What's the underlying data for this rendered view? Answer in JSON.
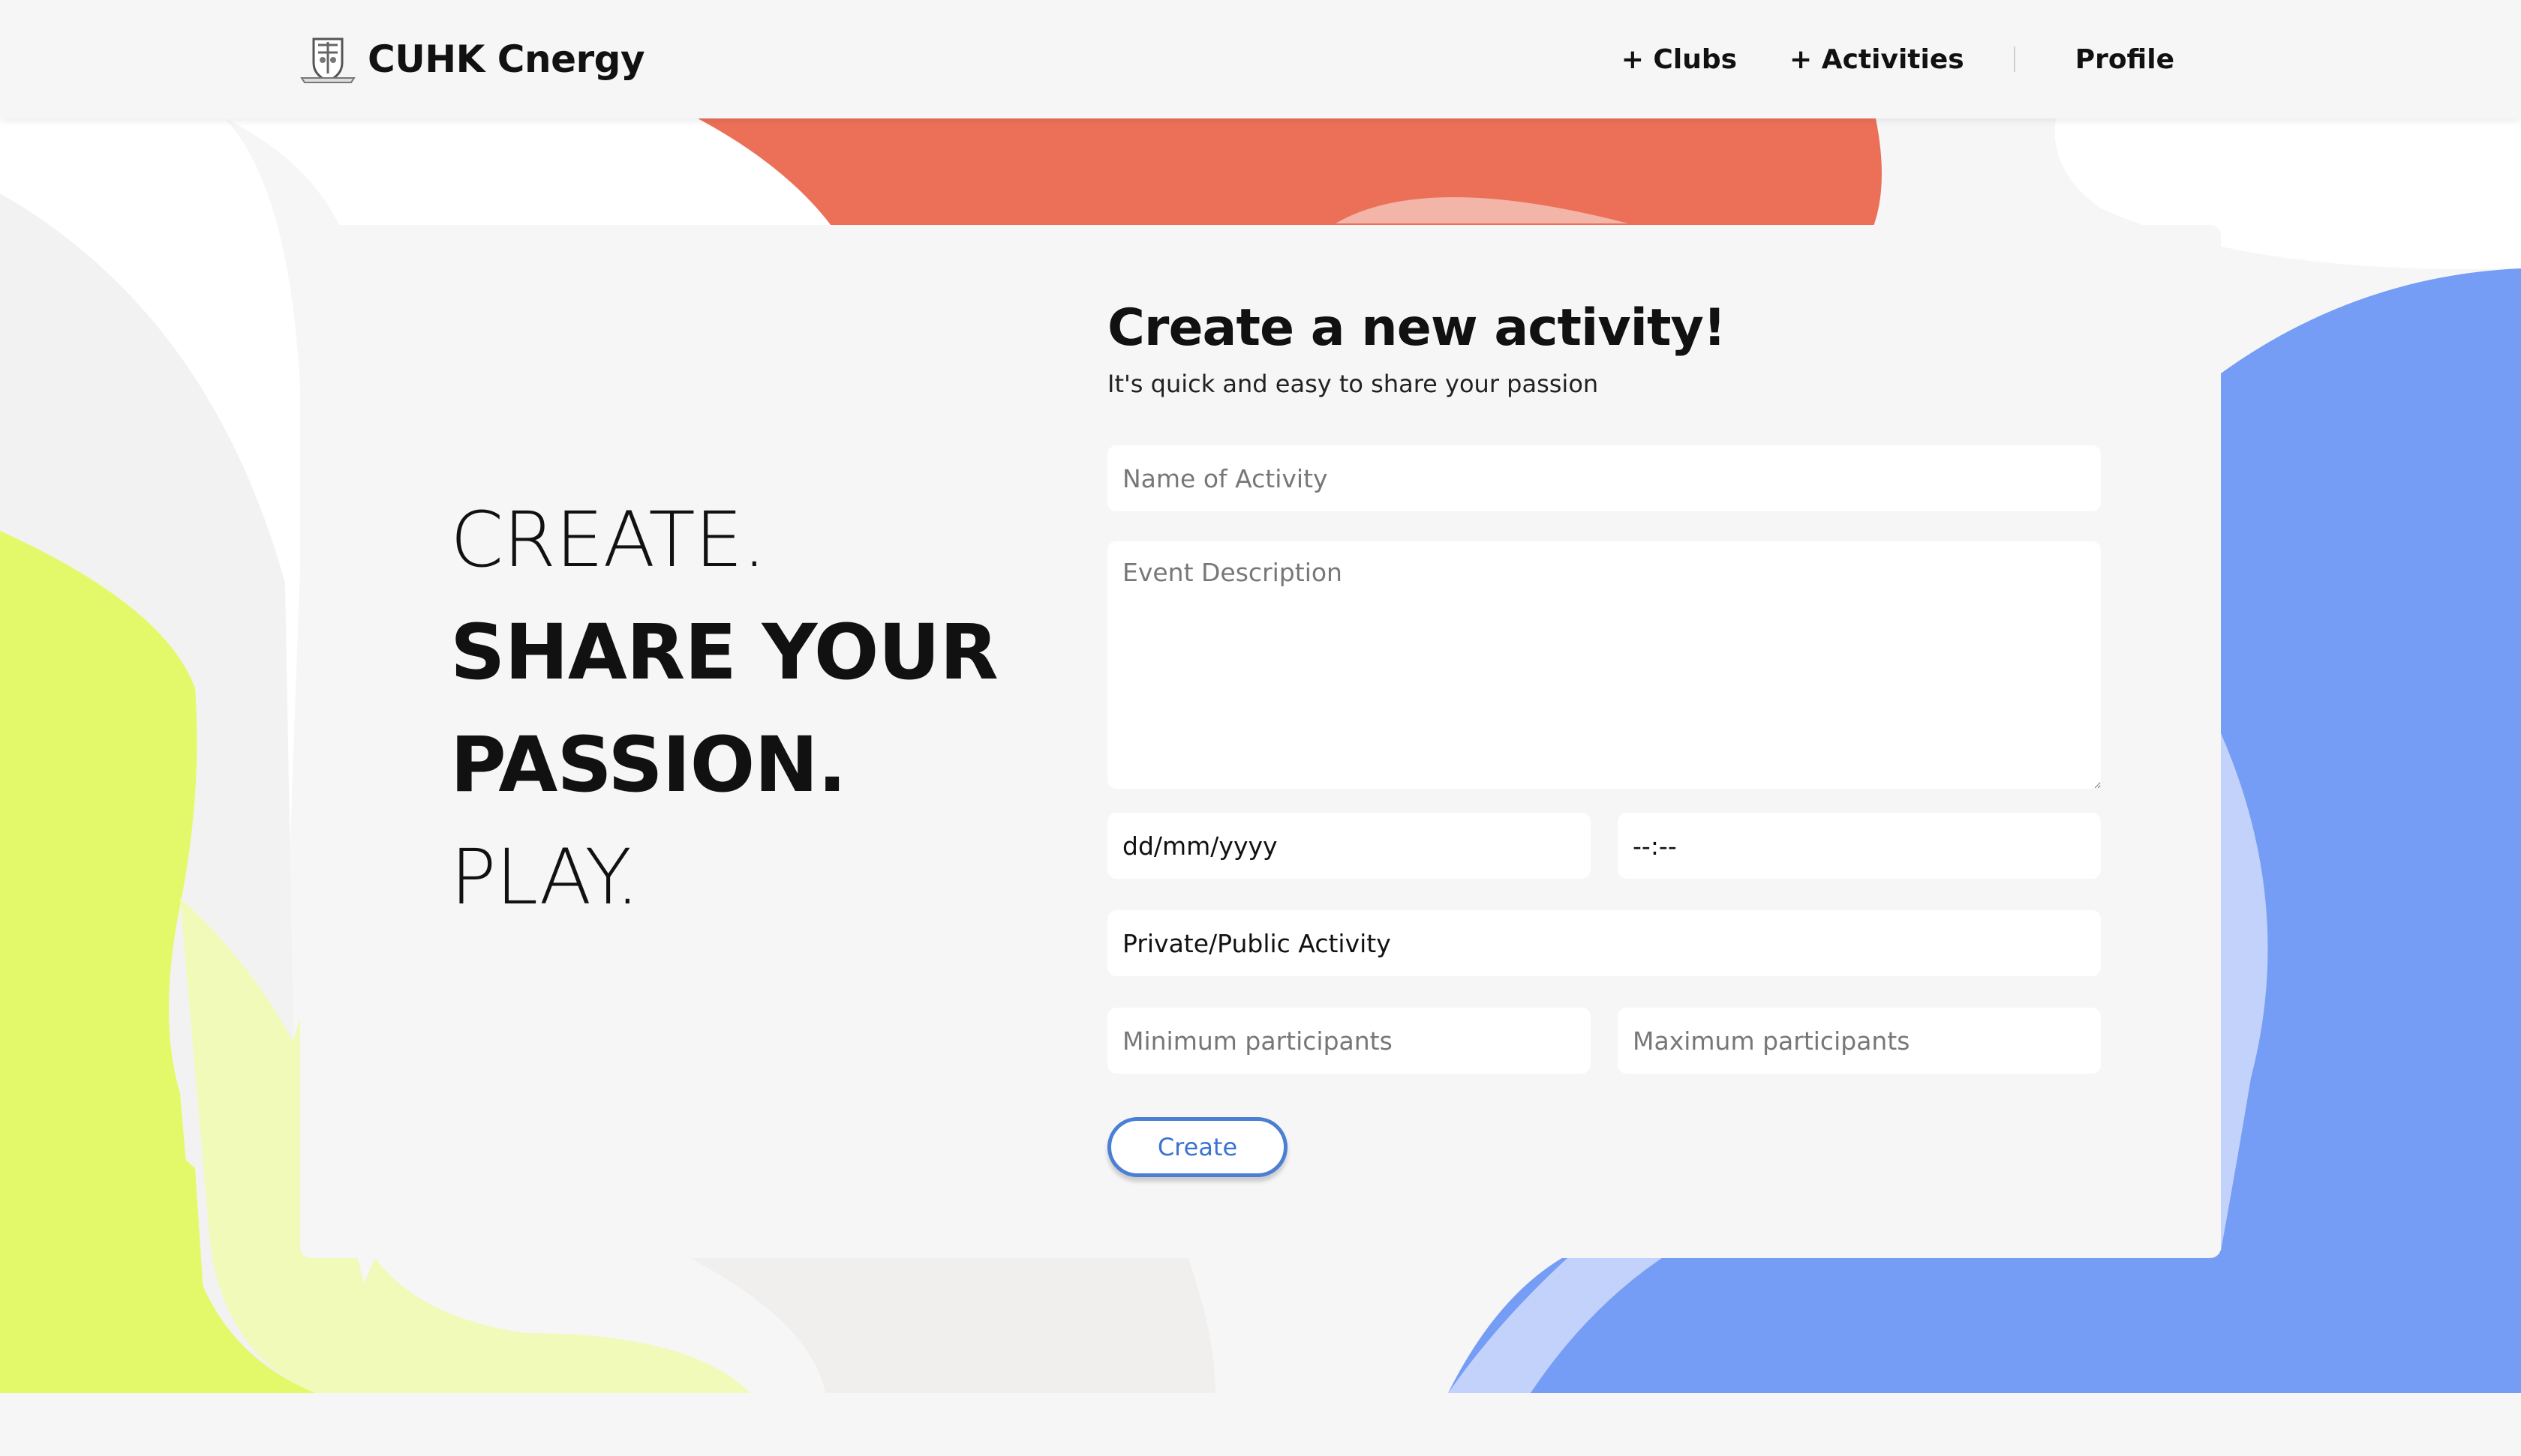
{
  "header": {
    "brand": "CUHK Cnergy",
    "logo_icon": "university-crest-icon",
    "nav": {
      "clubs": "+ Clubs",
      "activities": "+ Activities",
      "profile": "Profile"
    }
  },
  "slogan": {
    "line1": "CREATE.",
    "line2": "SHARE YOUR",
    "line3": "PASSION.",
    "line4": "PLAY."
  },
  "form": {
    "title": "Create a new activity!",
    "subtitle": "It's quick and easy to share your passion",
    "name_placeholder": "Name of Activity",
    "description_placeholder": "Event Description",
    "date_value": "dd/mm/yyyy",
    "time_value": "--:--",
    "privacy_value": "Private/Public Activity",
    "min_placeholder": "Minimum participants",
    "max_placeholder": "Maximum participants",
    "submit_label": "Create"
  },
  "colors": {
    "accent_blue": "#4a7fd4",
    "blob_red": "#ec7058",
    "blob_lime": "#e4f96a",
    "blob_blue": "#769df5"
  }
}
